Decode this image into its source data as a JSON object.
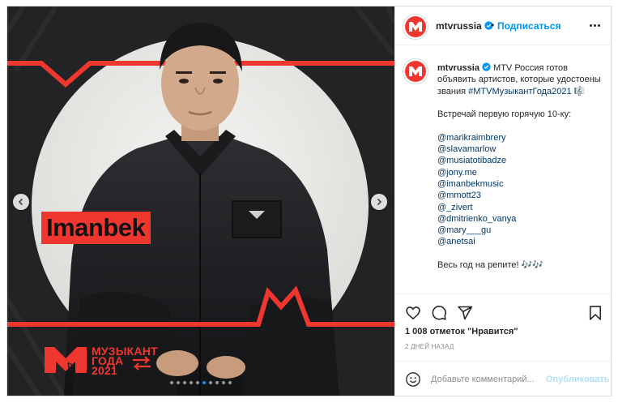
{
  "media": {
    "name_label": "Imanbek",
    "logo_line1": "МУЗЫКАНТ",
    "logo_line2": "ГОДА",
    "logo_line3": "2021",
    "accent_color": "#f0372f",
    "slide_count": 10,
    "active_slide": 5
  },
  "header": {
    "username": "mtvrussia",
    "separator": "•",
    "follow_label": "Подписаться",
    "verified_icon": "verified-badge-icon",
    "more_icon": "more-options-icon"
  },
  "caption": {
    "username": "mtvrussia",
    "text": "MTV Россия готов объявить артистов, которые удостоены звания",
    "hashtag": "#MTVМузыкантГода2021",
    "hashtag_emoji": "🎼",
    "intro": "Встречай первую горячую 10-ку:",
    "mentions": [
      "@marikraimbrery",
      "@slavamarlow",
      "@musiatotibadze",
      "@jony.me",
      "@imanbekmusic",
      "@mmott23",
      "@_zivert",
      "@dmitrienko_vanya",
      "@mary___gu",
      "@anetsai"
    ],
    "outro": "Весь год на репите! 🎶🎶"
  },
  "actions": {
    "likes": "1 008 отметок \"Нравится\"",
    "time": "2 ДНЕЙ НАЗАД"
  },
  "comment_box": {
    "placeholder": "Добавьте комментарий...",
    "publish_label": "Опубликовать"
  },
  "colors": {
    "link_blue": "#0095f6",
    "hashtag_blue": "#00376b",
    "publish_disabled": "#b2dffc"
  }
}
